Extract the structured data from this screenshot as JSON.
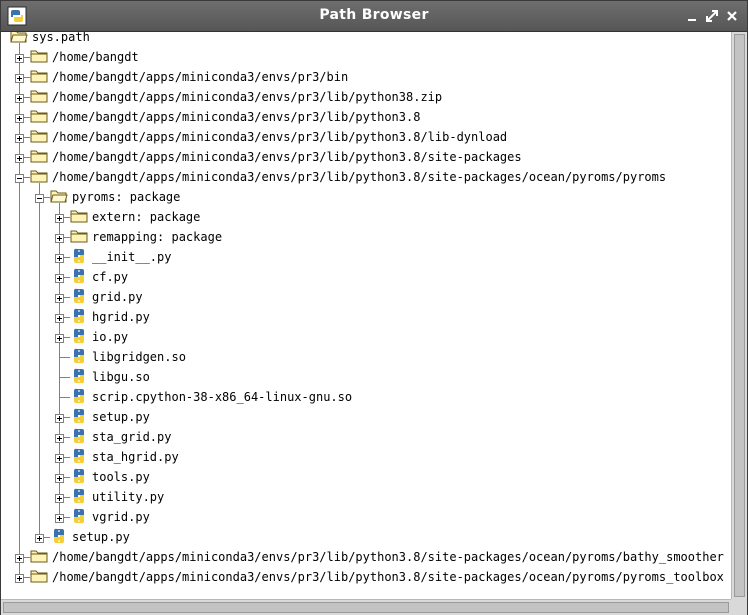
{
  "window": {
    "title": "Path Browser",
    "controls": [
      "minimize-icon",
      "maximize-icon",
      "close-icon"
    ]
  },
  "tree": {
    "rows": [
      {
        "label": "sys.path",
        "depth": 0,
        "icon": "folder-open-icon",
        "expander": "none"
      },
      {
        "label": "/home/bangdt",
        "depth": 1,
        "icon": "folder-icon",
        "expander": "plus"
      },
      {
        "label": "/home/bangdt/apps/miniconda3/envs/pr3/bin",
        "depth": 1,
        "icon": "folder-icon",
        "expander": "plus"
      },
      {
        "label": "/home/bangdt/apps/miniconda3/envs/pr3/lib/python38.zip",
        "depth": 1,
        "icon": "folder-icon",
        "expander": "plus"
      },
      {
        "label": "/home/bangdt/apps/miniconda3/envs/pr3/lib/python3.8",
        "depth": 1,
        "icon": "folder-icon",
        "expander": "plus"
      },
      {
        "label": "/home/bangdt/apps/miniconda3/envs/pr3/lib/python3.8/lib-dynload",
        "depth": 1,
        "icon": "folder-icon",
        "expander": "plus"
      },
      {
        "label": "/home/bangdt/apps/miniconda3/envs/pr3/lib/python3.8/site-packages",
        "depth": 1,
        "icon": "folder-icon",
        "expander": "plus"
      },
      {
        "label": "/home/bangdt/apps/miniconda3/envs/pr3/lib/python3.8/site-packages/ocean/pyroms/pyroms",
        "depth": 1,
        "icon": "folder-icon",
        "expander": "minus"
      },
      {
        "label": "pyroms: package",
        "depth": 2,
        "icon": "folder-open-icon",
        "expander": "minus"
      },
      {
        "label": "extern: package",
        "depth": 3,
        "icon": "folder-icon",
        "expander": "plus"
      },
      {
        "label": "remapping: package",
        "depth": 3,
        "icon": "folder-icon",
        "expander": "plus"
      },
      {
        "label": "__init__.py",
        "depth": 3,
        "icon": "python-file-icon",
        "expander": "plus"
      },
      {
        "label": "cf.py",
        "depth": 3,
        "icon": "python-file-icon",
        "expander": "plus"
      },
      {
        "label": "grid.py",
        "depth": 3,
        "icon": "python-file-icon",
        "expander": "plus"
      },
      {
        "label": "hgrid.py",
        "depth": 3,
        "icon": "python-file-icon",
        "expander": "plus"
      },
      {
        "label": "io.py",
        "depth": 3,
        "icon": "python-file-icon",
        "expander": "plus"
      },
      {
        "label": "libgridgen.so",
        "depth": 3,
        "icon": "python-file-icon",
        "expander": "none"
      },
      {
        "label": "libgu.so",
        "depth": 3,
        "icon": "python-file-icon",
        "expander": "none"
      },
      {
        "label": "scrip.cpython-38-x86_64-linux-gnu.so",
        "depth": 3,
        "icon": "python-file-icon",
        "expander": "none"
      },
      {
        "label": "setup.py",
        "depth": 3,
        "icon": "python-file-icon",
        "expander": "plus"
      },
      {
        "label": "sta_grid.py",
        "depth": 3,
        "icon": "python-file-icon",
        "expander": "plus"
      },
      {
        "label": "sta_hgrid.py",
        "depth": 3,
        "icon": "python-file-icon",
        "expander": "plus"
      },
      {
        "label": "tools.py",
        "depth": 3,
        "icon": "python-file-icon",
        "expander": "plus"
      },
      {
        "label": "utility.py",
        "depth": 3,
        "icon": "python-file-icon",
        "expander": "plus"
      },
      {
        "label": "vgrid.py",
        "depth": 3,
        "icon": "python-file-icon",
        "expander": "plus"
      },
      {
        "label": "setup.py",
        "depth": 2,
        "icon": "python-file-icon",
        "expander": "plus"
      },
      {
        "label": "/home/bangdt/apps/miniconda3/envs/pr3/lib/python3.8/site-packages/ocean/pyroms/bathy_smoother",
        "depth": 1,
        "icon": "folder-icon",
        "expander": "plus"
      },
      {
        "label": "/home/bangdt/apps/miniconda3/envs/pr3/lib/python3.8/site-packages/ocean/pyroms/pyroms_toolbox",
        "depth": 1,
        "icon": "folder-icon",
        "expander": "plus"
      }
    ]
  },
  "colors": {
    "titlebar": "#5f5f5f",
    "folder_fill": "#fff4b8",
    "folder_stroke": "#6b5a1a",
    "python_blue": "#3a72b0",
    "python_yellow": "#f4cf3a"
  }
}
